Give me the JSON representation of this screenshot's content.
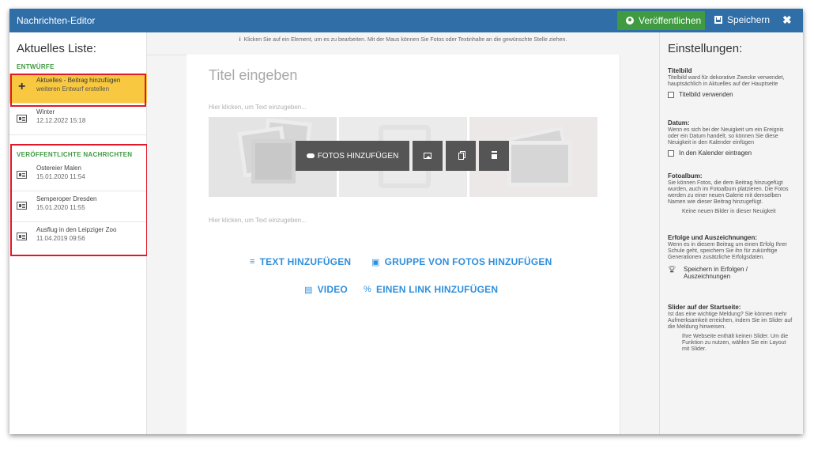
{
  "titlebar": {
    "title": "Nachrichten-Editor",
    "publish_label": "Veröffentlichen",
    "save_label": "Speichern",
    "close_label": "✖"
  },
  "sidebar": {
    "heading": "Aktuelles Liste:",
    "drafts_label": "ENTWÜRFE",
    "add_item": {
      "title": "Aktuelles - Beitrag hinzufügen",
      "subtitle": "weiteren Entwurf erstellen"
    },
    "drafts": [
      {
        "title": "Winter",
        "date": "12.12.2022 15:18"
      }
    ],
    "published_label": "VERÖFFENTLICHTE NACHRICHTEN",
    "published": [
      {
        "title": "Ostereier Malen",
        "date": "15.01.2020 11:54"
      },
      {
        "title": "Semperoper Dresden",
        "date": "15.01.2020 11:55"
      },
      {
        "title": "Ausflug in den Leipziger Zoo",
        "date": "11.04.2019 09:56"
      }
    ]
  },
  "editor": {
    "hint": "Klicken Sie auf ein Element, um es zu bearbeiten. Mit der Maus können Sie Fotos oder Textinhalte an die gewünschte Stelle ziehen.",
    "title_placeholder": "Titel eingeben",
    "text_placeholder_1": "Hier klicken, um Text einzugeben...",
    "text_placeholder_2": "Hier klicken, um Text einzugeben...",
    "add_photos_label": "FOTOS HINZUFÜGEN",
    "add_text": "TEXT HINZUFÜGEN",
    "add_photo_group": "GRUPPE VON FOTOS HINZUFÜGEN",
    "add_video": "VIDEO",
    "add_link": "EINEN LINK HINZUFÜGEN"
  },
  "settings": {
    "heading": "Einstellungen:",
    "titlebild": {
      "title": "Titelbild",
      "desc": "Titelbild ward für dekorative Zwecke verwendet, hauptsächlich in Aktuelles auf der Hauptseite",
      "checkbox": "Titelbild verwenden"
    },
    "datum": {
      "title": "Datum:",
      "desc": "Wenn es sich bei der Neuigkeit um ein Ereignis oder ein Datum handelt, so können Sie diese Neuigkeit in den Kalender einfügen",
      "checkbox": "In den Kalender eintragen"
    },
    "fotoalbum": {
      "title": "Fotoalbum:",
      "desc": "Sie können Fotos, die dem Beitrag hinzugefügt wurden, auch im Fotoalbum platzieren. Die Fotos werden zu einer neuen Galerie mit demselben Namen wie dieser Beitrag hinzugefügt.",
      "note": "Keine neuen Bilder in dieser Neuigkeit"
    },
    "erfolge": {
      "title": "Erfolge und Auszeichnungen:",
      "desc": "Wenn es in diesem Beitrag um einen Erfolg Ihrer Schule geht, speichern Sie ihn für zukünftige Generationen zusätzliche Erfolgsdaten.",
      "action": "Speichern in Erfolgen / Auszeichnungen"
    },
    "slider": {
      "title": "Slider auf der Startseite:",
      "desc": "Ist das eine wichtige Meldung? Sie können mehr Aufmerksamkeit erreichen, indem Sie im Slider auf die Meldung hinweisen.",
      "note": "Ihre Webseite enthält keinen Slider. Um die Funktion zu nutzen, wählen Sie ein Layout mit Slider."
    }
  },
  "colors": {
    "titlebar": "#2f6ea7",
    "publish": "#3f9a41",
    "highlight": "#f8c940",
    "link": "#2f8fdc",
    "annotation": "#e0182a"
  }
}
